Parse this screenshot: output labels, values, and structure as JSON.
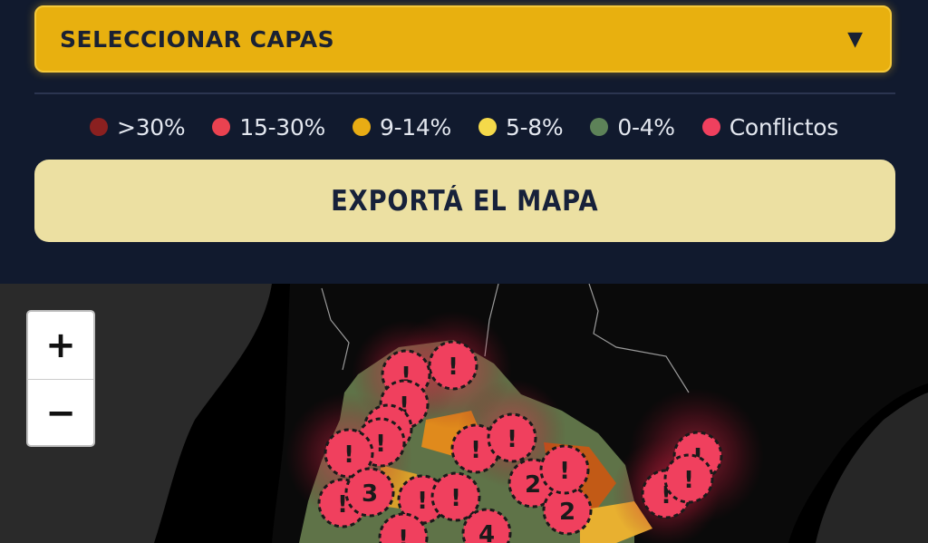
{
  "layer_selector": {
    "label": "SELECCIONAR CAPAS",
    "chevron": "▼"
  },
  "legend": {
    "items": [
      {
        "label": ">30%",
        "color": "#8a2020"
      },
      {
        "label": "15-30%",
        "color": "#ea4250"
      },
      {
        "label": "9-14%",
        "color": "#e8ac14"
      },
      {
        "label": "5-8%",
        "color": "#f5d94a"
      },
      {
        "label": "0-4%",
        "color": "#5d8258"
      },
      {
        "label": "Conflictos",
        "color": "#f0405e"
      }
    ]
  },
  "export_button": {
    "label": "EXPORTÁ EL MAPA"
  },
  "map": {
    "zoom_in": "+",
    "zoom_out": "−",
    "markers": [
      {
        "label": "!"
      },
      {
        "label": "!"
      },
      {
        "label": "!"
      },
      {
        "label": "!"
      },
      {
        "label": "!"
      },
      {
        "label": "!"
      },
      {
        "label": "!"
      },
      {
        "label": "3"
      },
      {
        "label": "!"
      },
      {
        "label": "!"
      },
      {
        "label": "!"
      },
      {
        "label": "!"
      },
      {
        "label": "2"
      },
      {
        "label": "2"
      },
      {
        "label": "!"
      },
      {
        "label": "4"
      },
      {
        "label": "!"
      },
      {
        "label": "!"
      },
      {
        "label": "!"
      },
      {
        "label": "!"
      }
    ]
  }
}
